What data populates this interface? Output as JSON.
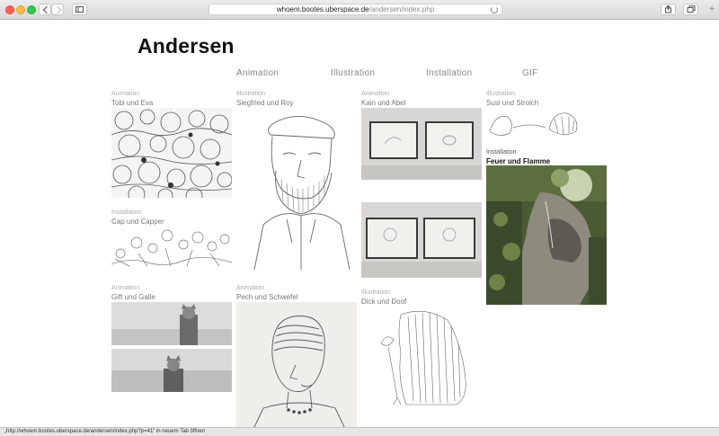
{
  "browser": {
    "url_host": "whoem.bootes.uberspace.de",
    "url_path": "/andersen/index.php"
  },
  "site": {
    "title": "Andersen"
  },
  "nav": [
    "Animation",
    "Illustration",
    "Installation",
    "GIF"
  ],
  "works": [
    {
      "category": "Animation",
      "title": "Tobi und Eva"
    },
    {
      "category": "Installation",
      "title": "Cap und Capper"
    },
    {
      "category": "Animation",
      "title": "Gift und Galle"
    },
    {
      "category": "Illustration",
      "title": "Siegfried und Roy"
    },
    {
      "category": "Animation",
      "title": "Pech und Schwefel"
    },
    {
      "category": "Animation",
      "title": "Kain und Abel"
    },
    {
      "category": "Illustration",
      "title": "Dick und Doof"
    },
    {
      "category": "Illustration",
      "title": "Susi und Strolch"
    },
    {
      "category": "Installation",
      "title": "Feuer und Flamme"
    }
  ],
  "status_text": "„http://whoem.bootes.uberspace.de/andersen/index.php?p=41“ in neuem Tab öffnen"
}
